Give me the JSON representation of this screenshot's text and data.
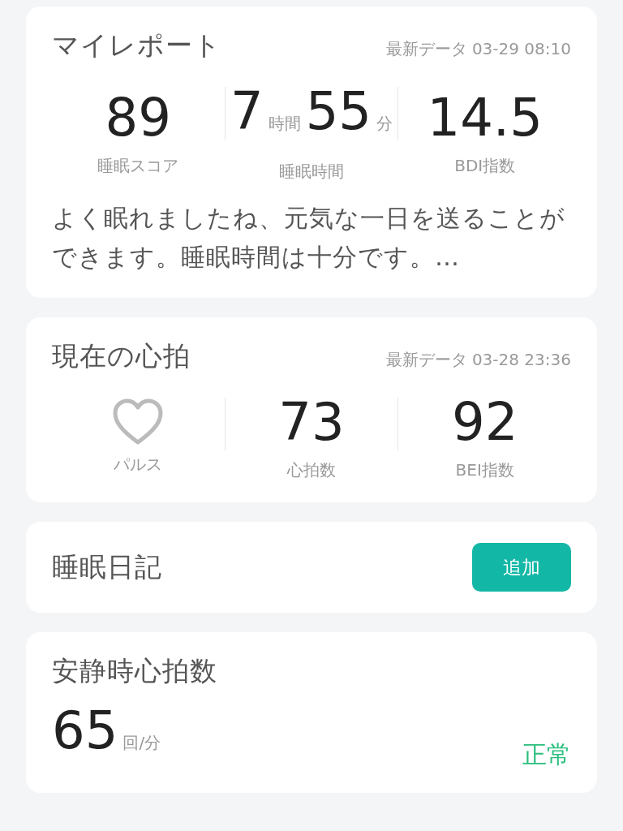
{
  "my_report": {
    "title": "マイレポート",
    "updated": "最新データ 03-29 08:10",
    "metrics": [
      {
        "kind": "number",
        "value": "89",
        "label": "睡眠スコア"
      },
      {
        "kind": "duration",
        "hours": "7",
        "hours_unit": "時間",
        "minutes": "55",
        "minutes_unit": "分",
        "label": "睡眠時間"
      },
      {
        "kind": "number",
        "value": "14.5",
        "label": "BDI指数"
      }
    ],
    "summary": "よく眠れましたね、元気な一日を送ることができます。睡眠時間は十分です。…"
  },
  "heart_rate": {
    "title": "現在の心拍",
    "updated": "最新データ 03-28 23:36",
    "metrics": [
      {
        "kind": "icon",
        "label": "パルス"
      },
      {
        "kind": "number",
        "value": "73",
        "label": "心拍数"
      },
      {
        "kind": "number",
        "value": "92",
        "label": "BEI指数"
      }
    ]
  },
  "sleep_diary": {
    "title": "睡眠日記",
    "button": "追加"
  },
  "resting_heart_rate": {
    "title": "安静時心拍数",
    "value": "65",
    "unit": "回/分",
    "status": "正常"
  }
}
